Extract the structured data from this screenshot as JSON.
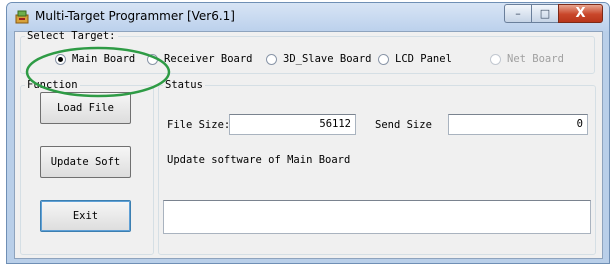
{
  "window": {
    "title": "Multi-Target Programmer [Ver6.1]",
    "caption_buttons": {
      "minimize": "–",
      "maximize": "□",
      "close": "X"
    }
  },
  "select_target": {
    "legend": "Select Target:",
    "options": [
      {
        "label": "Main Board",
        "selected": true,
        "enabled": true
      },
      {
        "label": "Receiver Board",
        "selected": false,
        "enabled": true
      },
      {
        "label": "3D_Slave Board",
        "selected": false,
        "enabled": true
      },
      {
        "label": "LCD Panel",
        "selected": false,
        "enabled": true
      },
      {
        "label": "Net Board",
        "selected": false,
        "enabled": false
      }
    ]
  },
  "function": {
    "legend": "Function",
    "buttons": {
      "load": "Load File",
      "update": "Update Soft",
      "exit": "Exit"
    }
  },
  "status": {
    "legend": "Status",
    "file_size_label": "File Size:",
    "file_size_value": "56112",
    "send_size_label": "Send Size",
    "send_size_value": "0",
    "message": "Update software of Main Board",
    "log": ""
  },
  "annotation": {
    "shape": "ellipse",
    "color": "#2e9b45",
    "highlights": "Main Board"
  },
  "icons": {
    "app": "programmer-app-icon"
  }
}
